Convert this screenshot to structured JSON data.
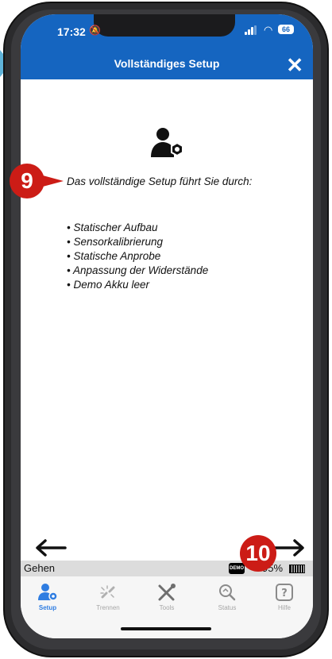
{
  "status_bar": {
    "time": "17:32",
    "battery": "66"
  },
  "header": {
    "title": "Vollständiges Setup",
    "close_label": "✕"
  },
  "content": {
    "intro": "Das vollständige Setup führt Sie durch:",
    "items": [
      "• Statischer Aufbau",
      "• Sensorkalibrierung",
      "• Statische Anprobe",
      "• Anpassung der Widerstände",
      "• Demo Akku leer"
    ]
  },
  "info_bar": {
    "mode": "Gehen",
    "demo_label": "DEMO",
    "battery_percent": "95%"
  },
  "tabs": [
    {
      "label": "Setup",
      "icon": "user-gear-icon",
      "active": true
    },
    {
      "label": "Trennen",
      "icon": "unlink-icon",
      "active": false
    },
    {
      "label": "Tools",
      "icon": "tools-icon",
      "active": false
    },
    {
      "label": "Status",
      "icon": "status-search-icon",
      "active": false
    },
    {
      "label": "Hilfe",
      "icon": "help-icon",
      "active": false
    }
  ],
  "annotations": {
    "callout_9": "9",
    "callout_10": "10"
  },
  "colors": {
    "primary": "#1565c0",
    "active_tab": "#2f7de1",
    "callout": "#cc1c16"
  }
}
